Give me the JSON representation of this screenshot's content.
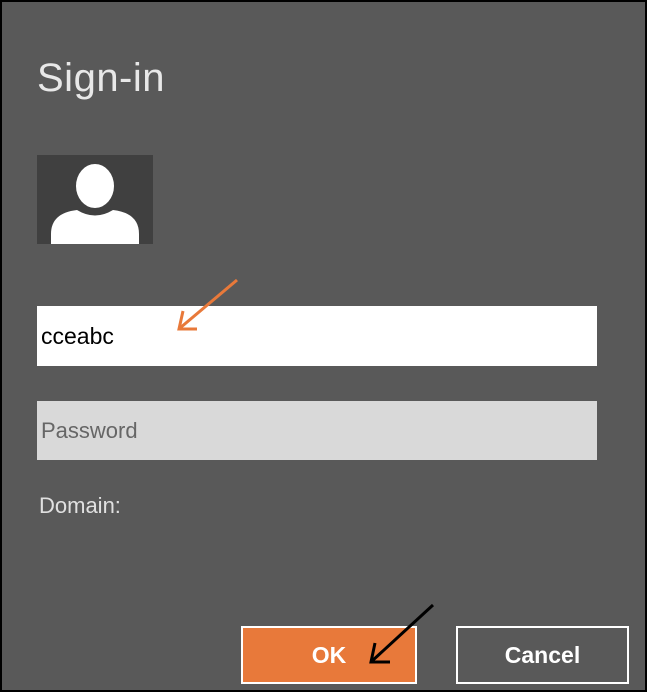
{
  "dialog": {
    "title": "Sign-in",
    "user_tile_icon": "user-silhouette-icon",
    "username": {
      "value": "cceabc"
    },
    "password": {
      "placeholder": "Password",
      "value": ""
    },
    "domain_label": "Domain:",
    "buttons": {
      "ok_label": "OK",
      "cancel_label": "Cancel"
    }
  },
  "annotations": {
    "username_arrow_icon": "arrow-icon",
    "username_arrow_color": "#e8793a",
    "ok_arrow_icon": "arrow-icon",
    "ok_arrow_color": "#000000"
  },
  "colors": {
    "dialog_background": "#595959",
    "accent": "#e8793a",
    "text_light": "#e8e8e8"
  }
}
